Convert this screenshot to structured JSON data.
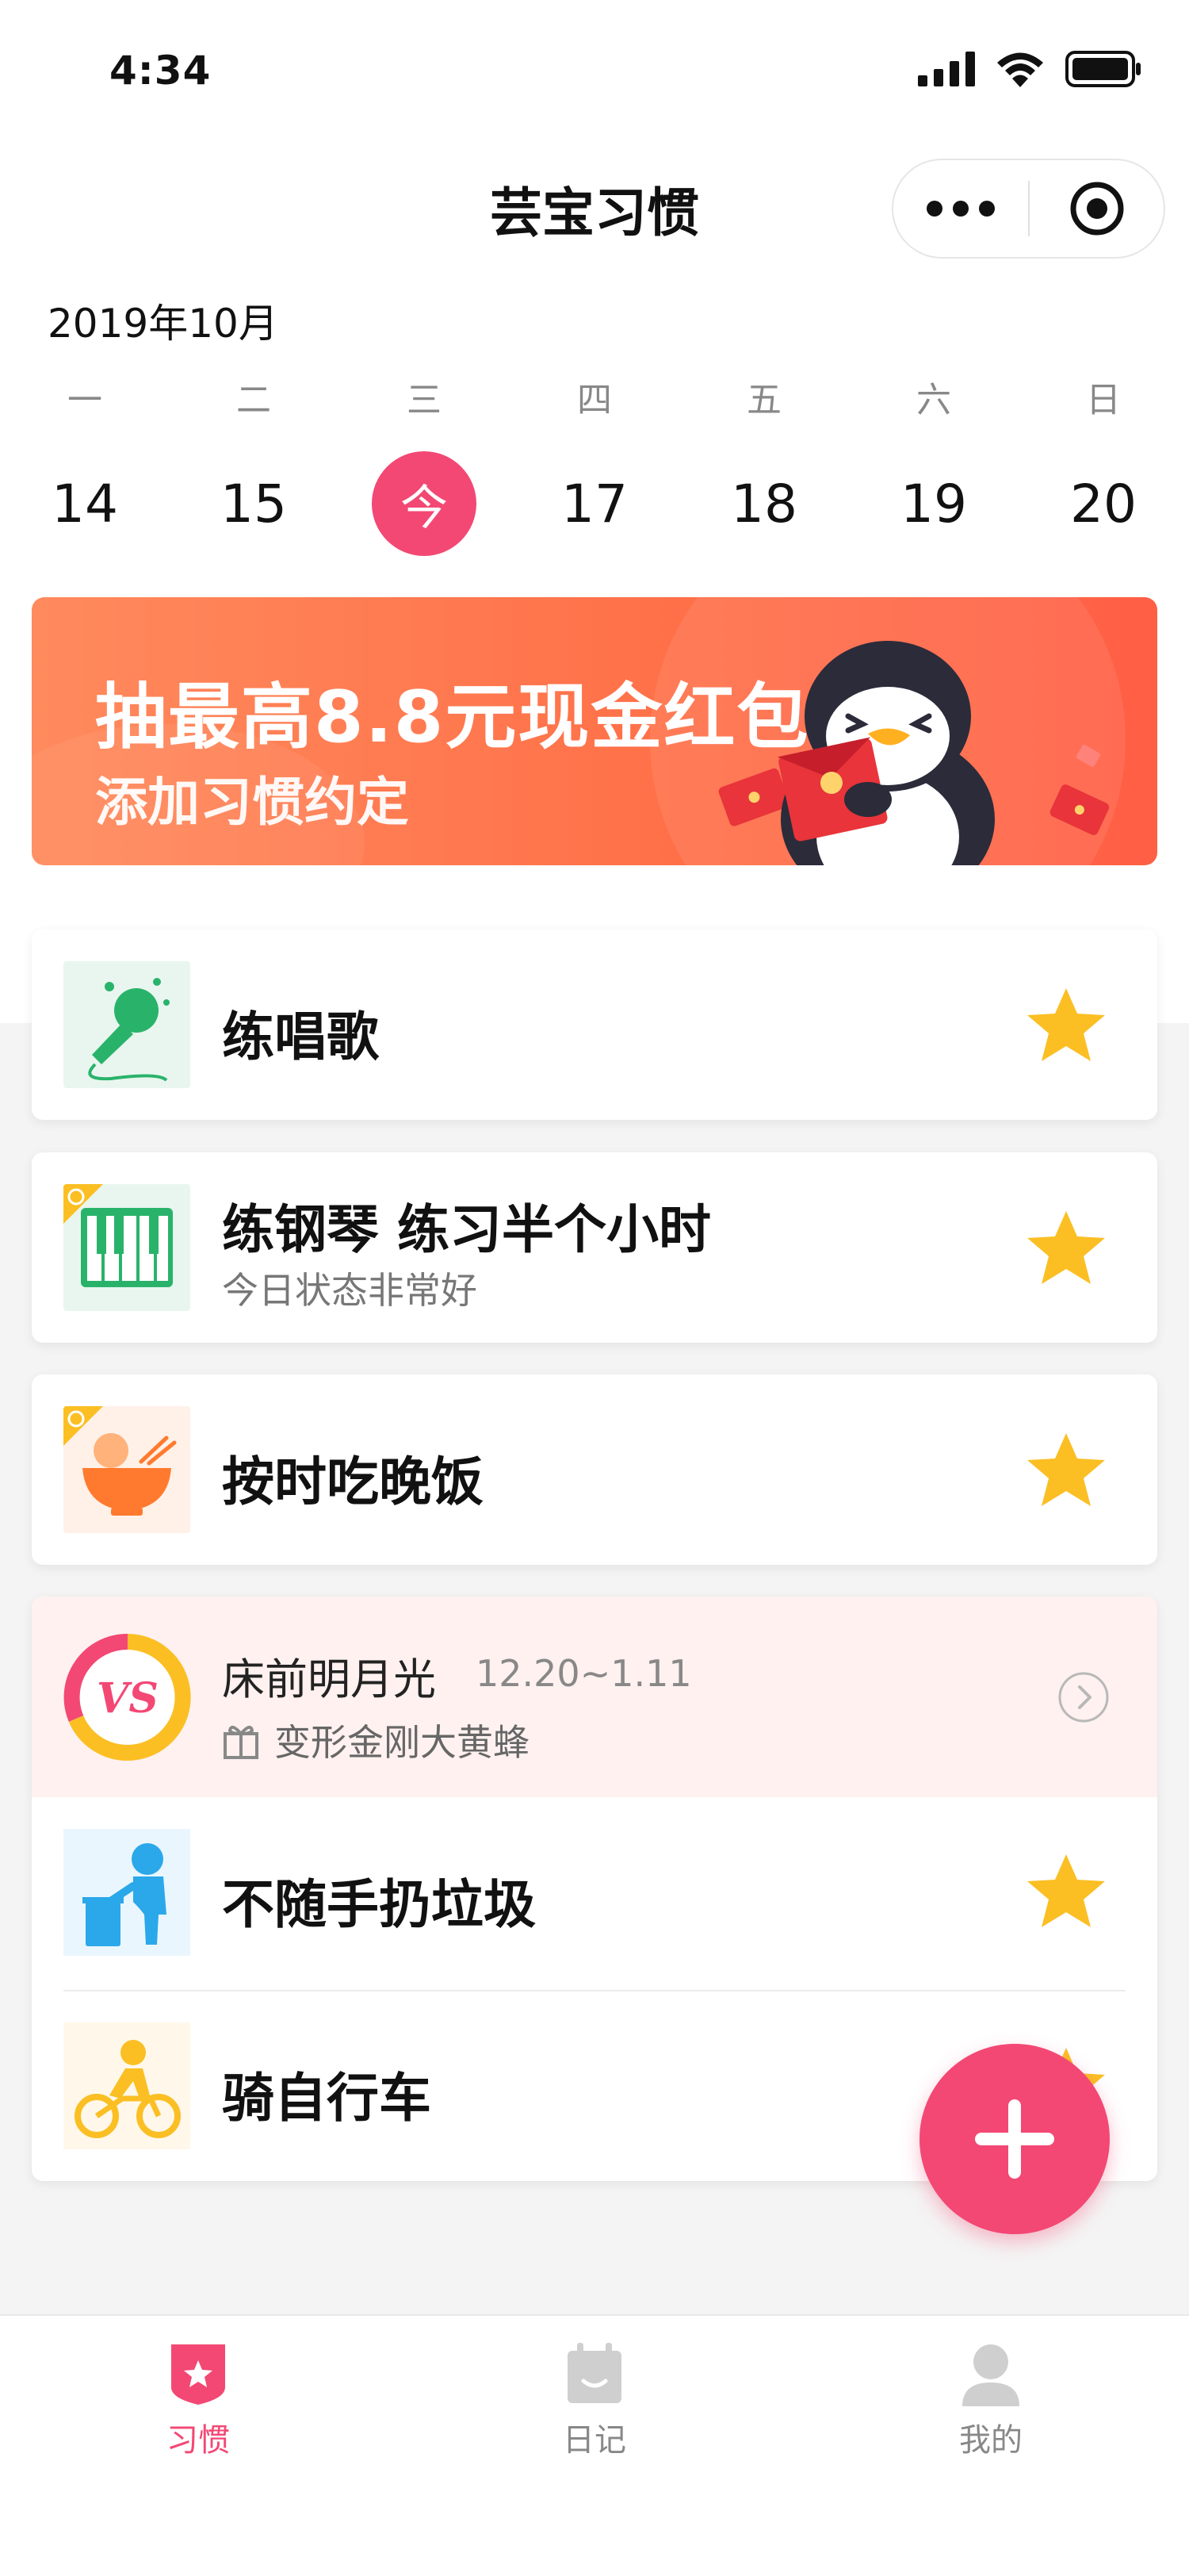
{
  "status_bar": {
    "time": "4:34"
  },
  "nav": {
    "title": "芸宝习惯"
  },
  "calendar": {
    "month": "2019年10月",
    "weekdays": [
      "一",
      "二",
      "三",
      "四",
      "五",
      "六",
      "日"
    ],
    "dates": [
      "14",
      "15",
      "今",
      "17",
      "18",
      "19",
      "20"
    ],
    "selected_index": 2
  },
  "banner": {
    "title": "抽最高8.8元现金红包",
    "subtitle": "添加习惯约定"
  },
  "habits": [
    {
      "name": "练唱歌",
      "note": "",
      "icon": "microphone-icon",
      "starred": true
    },
    {
      "name": "练钢琴 练习半个小时",
      "note": "今日状态非常好",
      "icon": "piano-icon",
      "starred": true,
      "alarm": true
    },
    {
      "name": "按时吃晚饭",
      "note": "",
      "icon": "bowl-icon",
      "starred": true,
      "alarm": true
    }
  ],
  "challenge": {
    "title": "床前明月光",
    "dates": "12.20~1.11",
    "prize": "变形金刚大黄蜂",
    "badge": "VS"
  },
  "group_habits": [
    {
      "name": "不随手扔垃圾",
      "icon": "trash-person-icon",
      "starred": true
    },
    {
      "name": "骑自行车",
      "icon": "bicycle-icon",
      "starred": true
    }
  ],
  "tabs": [
    {
      "label": "习惯",
      "active": true
    },
    {
      "label": "日记",
      "active": false
    },
    {
      "label": "我的",
      "active": false
    }
  ],
  "colors": {
    "accent": "#f34874",
    "star": "#fbbf24",
    "banner": "#ff7149"
  }
}
